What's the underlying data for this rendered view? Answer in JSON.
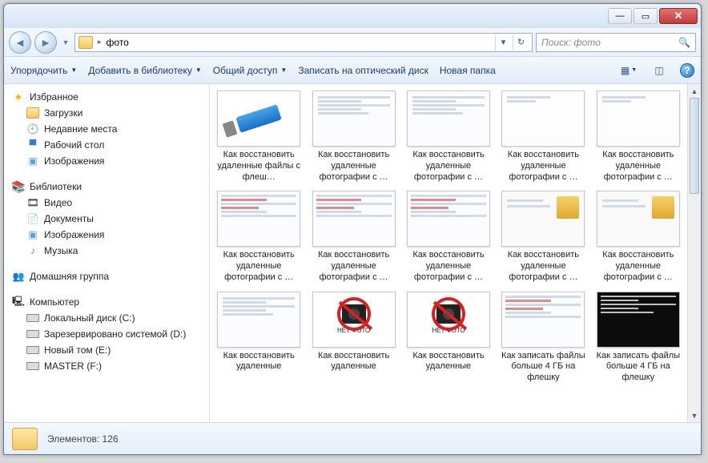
{
  "address": {
    "folder": "фото"
  },
  "search": {
    "placeholder": "Поиск: фото"
  },
  "toolbar": {
    "organize": "Упорядочить",
    "addlib": "Добавить в библиотеку",
    "share": "Общий доступ",
    "burn": "Записать на оптический диск",
    "newfolder": "Новая папка"
  },
  "sidebar": {
    "favorites": "Избранное",
    "fav": {
      "downloads": "Загрузки",
      "recent": "Недавние места",
      "desktop": "Рабочий стол",
      "images": "Изображения"
    },
    "libraries": "Библиотеки",
    "lib": {
      "video": "Видео",
      "docs": "Документы",
      "images": "Изображения",
      "music": "Музыка"
    },
    "homegroup": "Домашняя группа",
    "computer": "Компьютер",
    "drives": {
      "c": "Локальный диск (C:)",
      "d": "Зарезервировано системой (D:)",
      "e": "Новый том (E:)",
      "f": "MASTER (F:)"
    }
  },
  "items": [
    {
      "label": "Как восстановить удаленные файлы с флеш…",
      "kind": "usb"
    },
    {
      "label": "Как восстановить удаленные фотографии с …",
      "kind": "shot"
    },
    {
      "label": "Как восстановить удаленные фотографии с …",
      "kind": "shot"
    },
    {
      "label": "Как восстановить удаленные фотографии с …",
      "kind": "blank"
    },
    {
      "label": "Как восстановить удаленные фотографии с …",
      "kind": "blank"
    },
    {
      "label": "Как восстановить удаленные фотографии с …",
      "kind": "shotclr"
    },
    {
      "label": "Как восстановить удаленные фотографии с …",
      "kind": "shotclr"
    },
    {
      "label": "Как восстановить удаленные фотографии с …",
      "kind": "shotclr"
    },
    {
      "label": "Как восстановить удаленные фотографии с …",
      "kind": "box"
    },
    {
      "label": "Как восстановить удаленные фотографии с …",
      "kind": "box"
    },
    {
      "label": "Как восстановить удаленные",
      "kind": "shot"
    },
    {
      "label": "Как восстановить удаленные",
      "kind": "nophoto"
    },
    {
      "label": "Как восстановить удаленные",
      "kind": "nophoto"
    },
    {
      "label": "Как записать файлы больше 4 ГБ на флешку",
      "kind": "shotclr"
    },
    {
      "label": "Как записать файлы больше 4 ГБ на флешку",
      "kind": "cmd"
    }
  ],
  "nophoto_text": "НЕТ ФОТО",
  "status": {
    "elements_label": "Элементов:",
    "count": "126"
  }
}
